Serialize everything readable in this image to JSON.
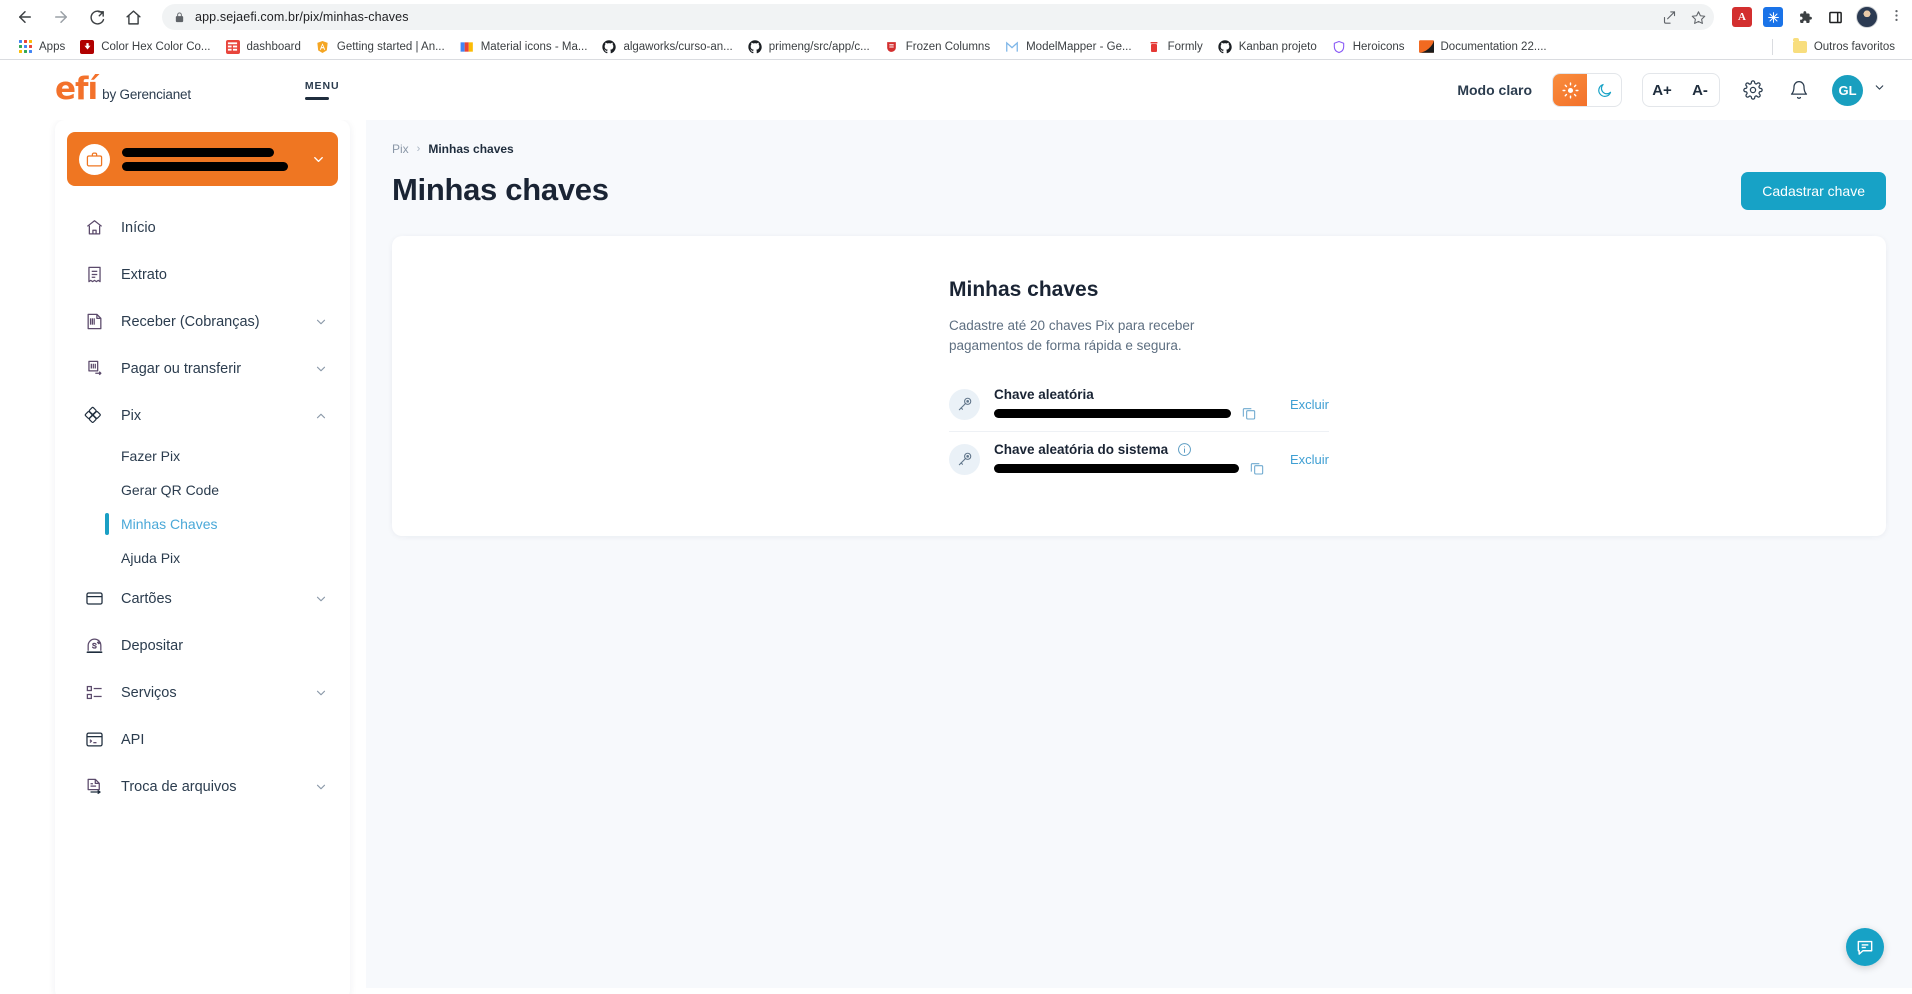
{
  "browser": {
    "url": "app.sejaefi.com.br/pix/minhas-chaves",
    "nav": {
      "back": "back-arrow",
      "forward": "forward-arrow",
      "reload": "reload",
      "home": "home"
    },
    "omnibox_actions": [
      "share-icon",
      "bookmark-star-icon"
    ],
    "extensions": [
      "adobe-acrobat-icon",
      "blue-snowflake-icon",
      "puzzle-extensions-icon",
      "sidepanel-icon",
      "profile-avatar",
      "kebab-menu-icon"
    ],
    "bookmarks": [
      {
        "label": "Apps",
        "icon": "apps-grid-icon"
      },
      {
        "label": "Color Hex Color Co...",
        "icon": "color-hex-icon"
      },
      {
        "label": "dashboard",
        "icon": "dashboard-icon"
      },
      {
        "label": "Getting started | An...",
        "icon": "angular-shield-icon"
      },
      {
        "label": "Material icons - Ma...",
        "icon": "material-icons-icon"
      },
      {
        "label": "algaworks/curso-an...",
        "icon": "github-icon"
      },
      {
        "label": "primeng/src/app/c...",
        "icon": "github-icon"
      },
      {
        "label": "Frozen Columns",
        "icon": "primeng-icon"
      },
      {
        "label": "ModelMapper - Ge...",
        "icon": "modelmapper-icon"
      },
      {
        "label": "Formly",
        "icon": "formly-icon"
      },
      {
        "label": "Kanban projeto",
        "icon": "github-icon"
      },
      {
        "label": "Heroicons",
        "icon": "heroicons-icon"
      },
      {
        "label": "Documentation 22....",
        "icon": "documentation-icon"
      }
    ],
    "other_bookmarks": {
      "label": "Outros favoritos",
      "icon": "folder-icon"
    }
  },
  "header": {
    "logo_primary": "efí",
    "logo_secondary": "by Gerencianet",
    "menu_label": "MENU",
    "mode_label": "Modo claro",
    "theme": {
      "light": "sun-icon",
      "dark": "moon-icon",
      "active": "light"
    },
    "font_increase": "A+",
    "font_decrease": "A-",
    "settings_icon": "gear-icon",
    "notifications_icon": "bell-icon",
    "user_initials": "GL",
    "user_chevron": "chevron-down-icon"
  },
  "sidebar": {
    "account": {
      "icon": "briefcase-icon",
      "name_redacted": true,
      "chevron": "chevron-down-icon"
    },
    "items": [
      {
        "label": "Início",
        "icon": "home-icon",
        "expandable": false
      },
      {
        "label": "Extrato",
        "icon": "receipt-icon",
        "expandable": false
      },
      {
        "label": "Receber (Cobranças)",
        "icon": "invoice-icon",
        "expandable": true
      },
      {
        "label": "Pagar ou transferir",
        "icon": "transfer-icon",
        "expandable": true
      },
      {
        "label": "Pix",
        "icon": "pix-icon",
        "expandable": true,
        "expanded": true,
        "children": [
          {
            "label": "Fazer Pix",
            "active": false
          },
          {
            "label": "Gerar QR Code",
            "active": false
          },
          {
            "label": "Minhas Chaves",
            "active": true
          },
          {
            "label": "Ajuda Pix",
            "active": false
          }
        ]
      },
      {
        "label": "Cartões",
        "icon": "card-icon",
        "expandable": true
      },
      {
        "label": "Depositar",
        "icon": "deposit-icon",
        "expandable": false
      },
      {
        "label": "Serviços",
        "icon": "services-icon",
        "expandable": true
      },
      {
        "label": "API",
        "icon": "terminal-icon",
        "expandable": false
      },
      {
        "label": "Troca de arquivos",
        "icon": "file-exchange-icon",
        "expandable": true
      }
    ]
  },
  "main": {
    "breadcrumb": {
      "parent": "Pix",
      "separator": "›",
      "current": "Minhas chaves"
    },
    "page_title": "Minhas chaves",
    "primary_button": "Cadastrar chave",
    "card": {
      "title": "Minhas chaves",
      "subtitle": "Cadastre até 20 chaves Pix para receber pagamentos de forma rápida e segura.",
      "keys": [
        {
          "label": "Chave aleatória",
          "value_redacted": true,
          "has_info": false,
          "copy_icon": "copy-icon",
          "delete_label": "Excluir"
        },
        {
          "label": "Chave aleatória do sistema",
          "value_redacted": true,
          "has_info": true,
          "info_icon": "info-icon",
          "copy_icon": "copy-icon",
          "delete_label": "Excluir"
        }
      ]
    },
    "chat_fab_icon": "chat-bubble-icon"
  },
  "colors": {
    "brand_orange": "#f3712b",
    "accent_teal": "#17a2c6",
    "link_blue": "#3f9fd3",
    "sidebar_text": "#2b3c4e",
    "page_bg": "#f7f9fc"
  }
}
